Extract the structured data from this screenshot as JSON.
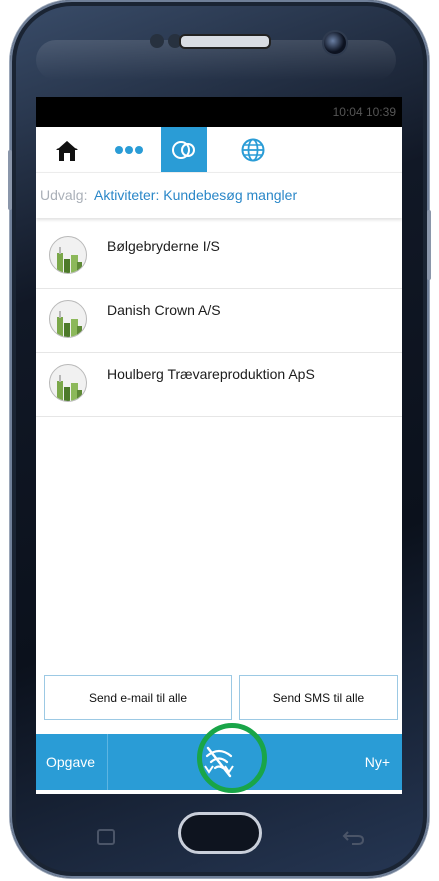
{
  "app": {
    "toolbar": [
      {
        "name": "home-icon",
        "active": false
      },
      {
        "name": "more-icon",
        "active": false
      },
      {
        "name": "circles-icon",
        "active": true
      },
      {
        "name": "globe-icon",
        "active": false
      }
    ]
  },
  "status": {
    "time": "10:04 10:39"
  },
  "filter": {
    "label": "Udvalg:",
    "value": "Aktiviteter: Kundebesøg mangler"
  },
  "customers": [
    {
      "name": "Bølgebryderne I/S"
    },
    {
      "name": "Danish Crown A/S"
    },
    {
      "name": "Houlberg Trævareproduktion ApS"
    }
  ],
  "actions": {
    "email_label": "Send e-mail til alle",
    "sms_label": "Send SMS til alle"
  },
  "bottom": {
    "left_label": "Opgave",
    "right_label": "Ny+",
    "center_icon": "offline-sync-icon"
  },
  "colors": {
    "accent": "#2a9cd6",
    "link": "#2a87c8",
    "highlight_ring": "#19a548",
    "avatar_green": "#7ba84a"
  }
}
